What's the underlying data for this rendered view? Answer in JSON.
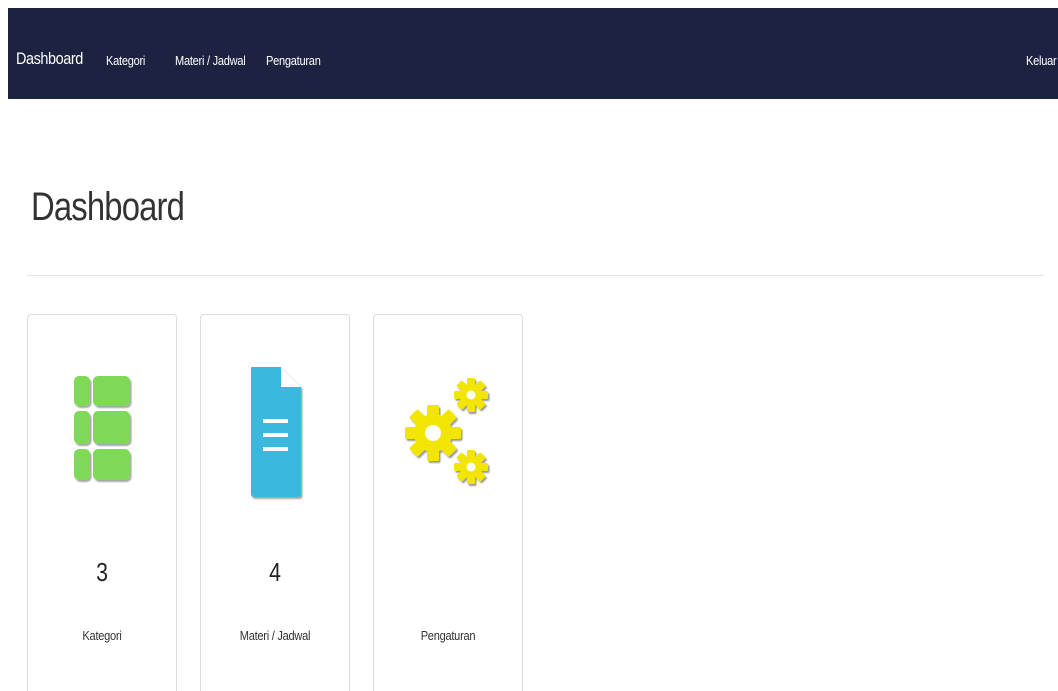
{
  "navbar": {
    "brand": "Dashboard",
    "links": [
      "Kategori",
      "Materi / Jadwal",
      "Pengaturan"
    ],
    "logout": "Keluar",
    "background": "#1b2340"
  },
  "page": {
    "title": "Dashboard"
  },
  "tiles": [
    {
      "icon": "grid-list-icon",
      "count": "3",
      "label": "Kategori",
      "color": "#7ed957"
    },
    {
      "icon": "document-icon",
      "count": "4",
      "label": "Materi / Jadwal",
      "color": "#3bb8dd"
    },
    {
      "icon": "gears-icon",
      "count": "",
      "label": "Pengaturan",
      "color": "#f2e500"
    }
  ]
}
